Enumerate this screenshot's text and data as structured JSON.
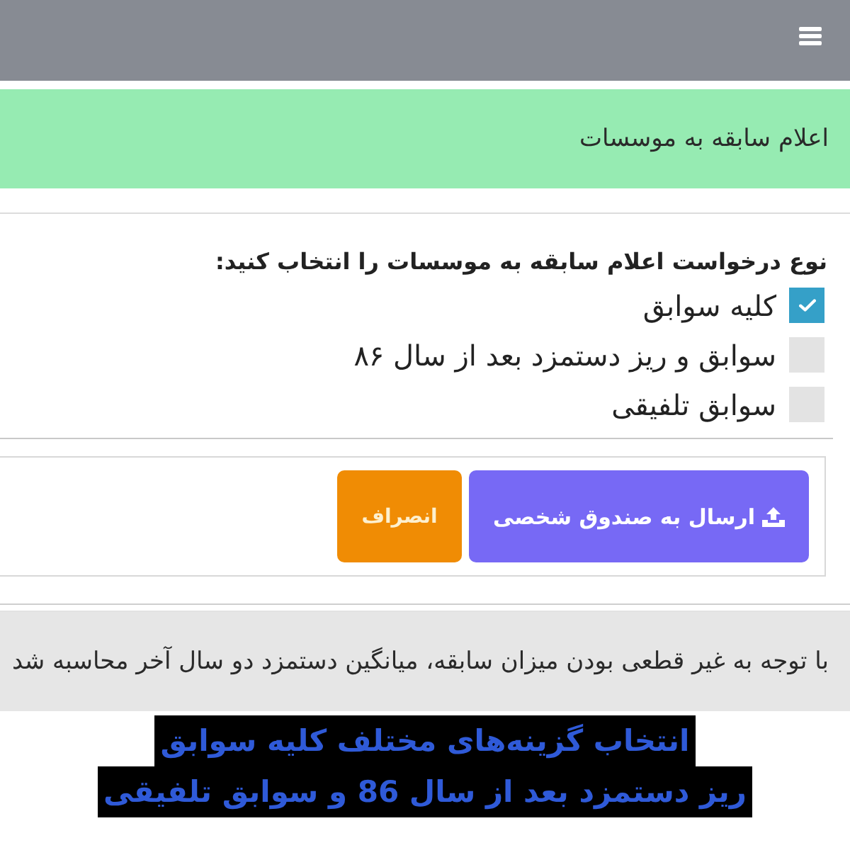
{
  "banner": {
    "title": "اعلام سابقه به موسسات"
  },
  "form": {
    "heading": "نوع درخواست اعلام سابقه به موسسات را انتخاب کنید:",
    "options": [
      {
        "label": "کلیه سوابق",
        "checked": true
      },
      {
        "label": "سوابق و ریز دستمزد بعد از سال ۸۶",
        "checked": false
      },
      {
        "label": "سوابق تلفیقی",
        "checked": false
      }
    ]
  },
  "buttons": [
    {
      "label": "ارسال به صندوق شخصی",
      "kind": "primary"
    },
    {
      "label": "انصراف",
      "kind": "cancel"
    }
  ],
  "note": "با توجه به غیر قطعی بودن میزان سابقه، میانگین دستمزد دو سال آخر محاسبه شد",
  "caption": [
    "انتخاب گزینه‌های مختلف کلیه سوابق",
    "ریز دستمزد بعد از سال 86 و سوابق تلفیقی"
  ]
}
